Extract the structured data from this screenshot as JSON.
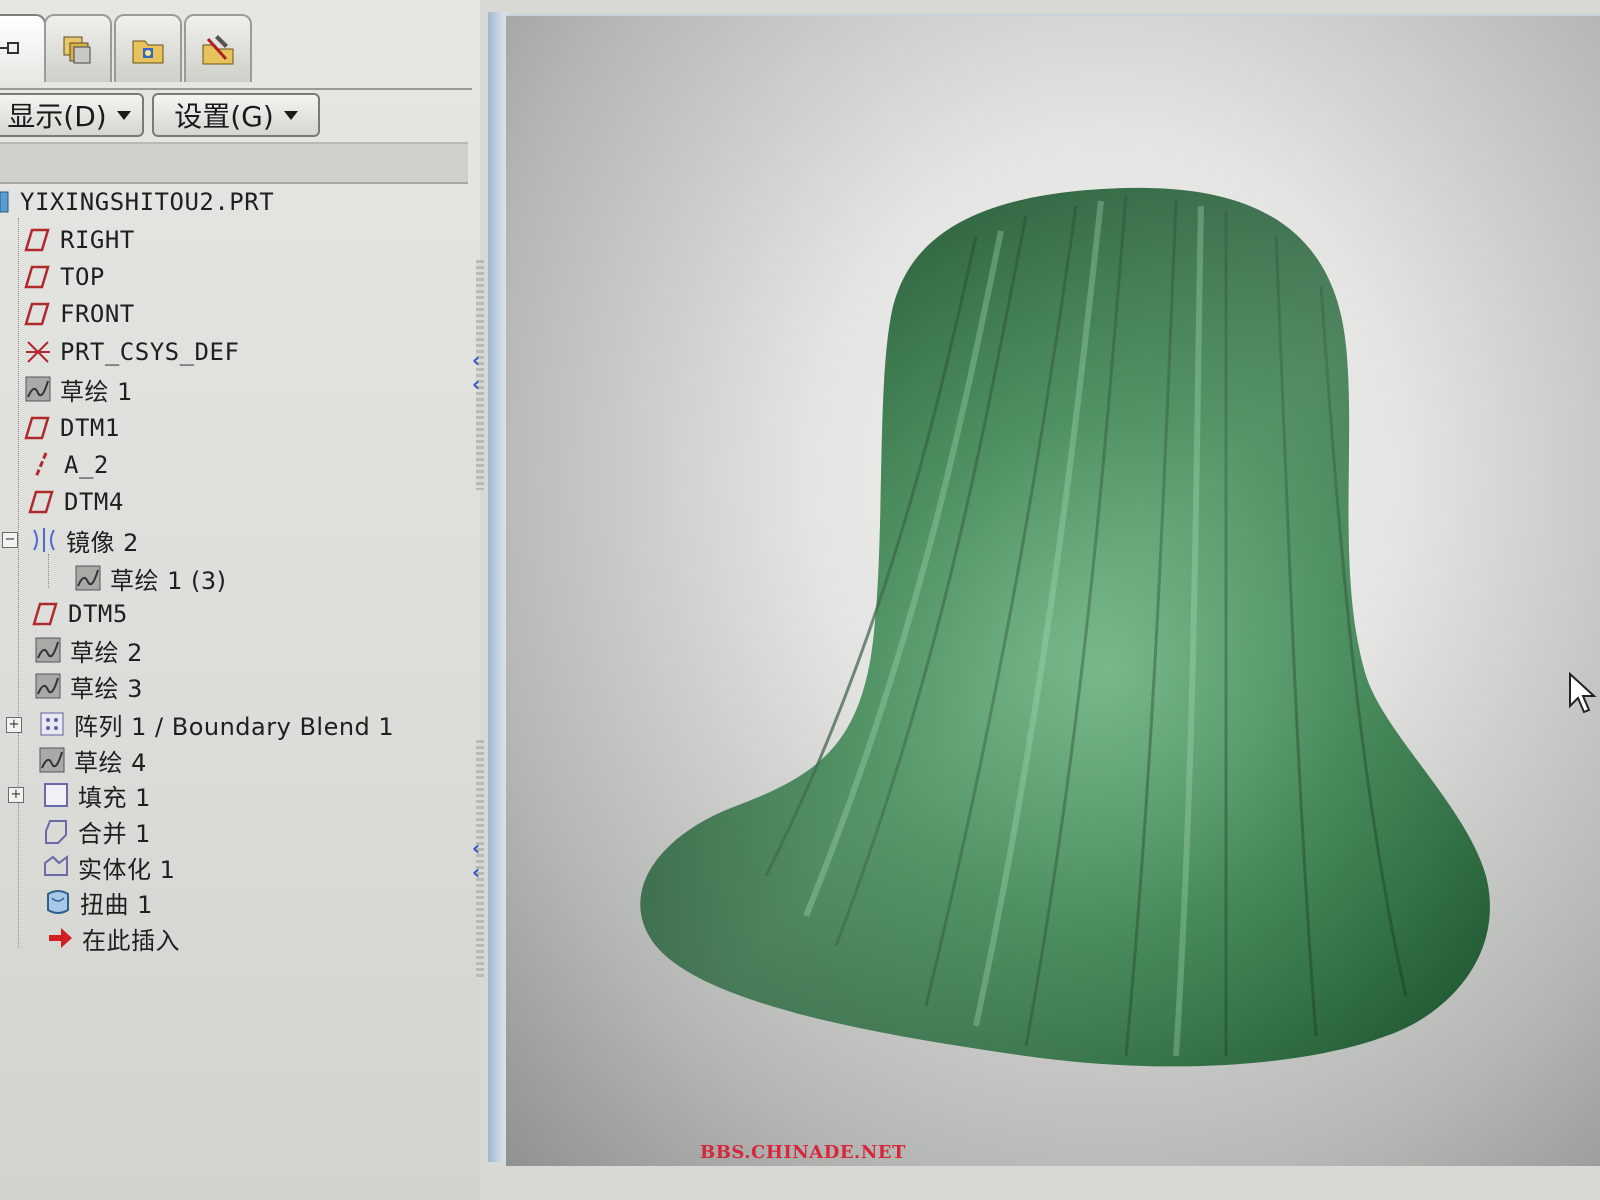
{
  "toolbar": {
    "tabs": [
      "model-tree-tab",
      "layers-tab",
      "folder-tab",
      "tools-tab"
    ],
    "display_menu": "显示(D)",
    "settings_menu": "设置(G)"
  },
  "model_tree": {
    "root": "YIXINGSHITOU2.PRT",
    "items": [
      {
        "label": "RIGHT",
        "icon": "datum-plane-icon"
      },
      {
        "label": "TOP",
        "icon": "datum-plane-icon"
      },
      {
        "label": "FRONT",
        "icon": "datum-plane-icon"
      },
      {
        "label": "PRT_CSYS_DEF",
        "icon": "csys-icon"
      },
      {
        "label": "草绘 1",
        "icon": "sketch-icon"
      },
      {
        "label": "DTM1",
        "icon": "datum-plane-icon"
      },
      {
        "label": "A_2",
        "icon": "datum-axis-icon"
      },
      {
        "label": "DTM4",
        "icon": "datum-plane-icon"
      },
      {
        "label": "镜像 2",
        "icon": "mirror-icon"
      },
      {
        "label": "草绘 1 (3)",
        "icon": "sketch-icon"
      },
      {
        "label": "DTM5",
        "icon": "datum-plane-icon"
      },
      {
        "label": "草绘 2",
        "icon": "sketch-icon"
      },
      {
        "label": "草绘 3",
        "icon": "sketch-icon"
      },
      {
        "label": "阵列 1 / Boundary Blend 1",
        "icon": "pattern-icon"
      },
      {
        "label": "草绘 4",
        "icon": "sketch-icon"
      },
      {
        "label": "填充 1",
        "icon": "fill-icon"
      },
      {
        "label": "合并 1",
        "icon": "merge-icon"
      },
      {
        "label": "实体化 1",
        "icon": "solidify-icon"
      },
      {
        "label": "扭曲 1",
        "icon": "warp-icon"
      },
      {
        "label": "在此插入",
        "icon": "insert-here-icon"
      }
    ]
  },
  "viewport": {
    "model_color": "#2f7a45",
    "background": "#e4e4e2"
  },
  "watermark": "BBS.CHINADE.NET"
}
